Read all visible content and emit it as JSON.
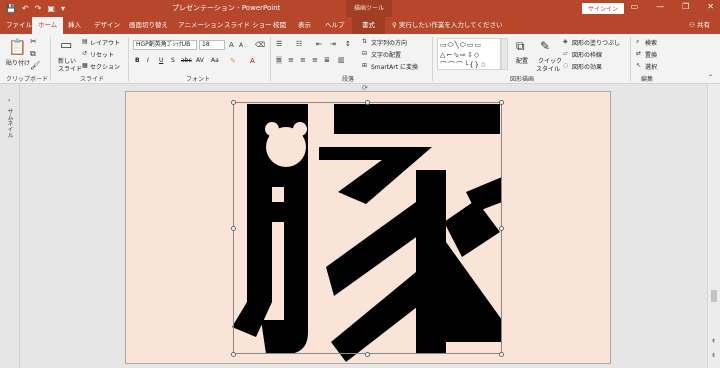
{
  "titlebar": {
    "qat": [
      "💾",
      "↶",
      "↷",
      "▣",
      "▾"
    ],
    "doc_title": "プレゼンテーション - PowerPoint",
    "context_title": "描画ツール",
    "signin": "サインイン",
    "controls": [
      "▭",
      "—",
      "❐",
      "✕"
    ]
  },
  "tabs": {
    "file": "ファイル",
    "home": "ホーム",
    "insert": "挿入",
    "design": "デザイン",
    "transitions": "画面切り替え",
    "animations": "アニメーション",
    "slideshow": "スライド ショー",
    "review": "校閲",
    "view": "表示",
    "help": "ヘルプ",
    "format": "書式"
  },
  "tell_me": "実行したい作業を入力してください",
  "share": "共有",
  "ribbon": {
    "clipboard": {
      "paste": "貼り付け",
      "label": "クリップボード"
    },
    "slides": {
      "new_slide": "新しい",
      "new_slide2": "スライド",
      "layout": "レイアウト",
      "reset": "リセット",
      "section": "セクション",
      "label": "スライド"
    },
    "font": {
      "name": "HGP創英角ｺﾞｼｯｸUB",
      "size": "18",
      "label": "フォント",
      "bold": "B",
      "italic": "I",
      "underline": "U",
      "shadow": "S",
      "strike": "abc",
      "spacing": "AV",
      "case": "Aa"
    },
    "paragraph": {
      "direction": "文字列の方向",
      "align": "文字の配置",
      "smartart": "SmartArt に変換",
      "label": "段落"
    },
    "drawing": {
      "arrange": "配置",
      "quick_styles": "クイック",
      "quick_styles2": "スタイル",
      "fill": "図形の塗りつぶし",
      "outline": "図形の枠線",
      "effects": "図形の効果",
      "label": "図形描画"
    },
    "editing": {
      "find": "検索",
      "replace": "置換",
      "select": "選択",
      "label": "編集"
    }
  },
  "thumbnails_label": "サムネイル",
  "slide": {
    "background": "#fae4d7",
    "glyph_color": "#000000"
  },
  "colors": {
    "accent": "#b7472a",
    "ribbon": "#f3f3f3",
    "canvas": "#e6e6e6"
  }
}
